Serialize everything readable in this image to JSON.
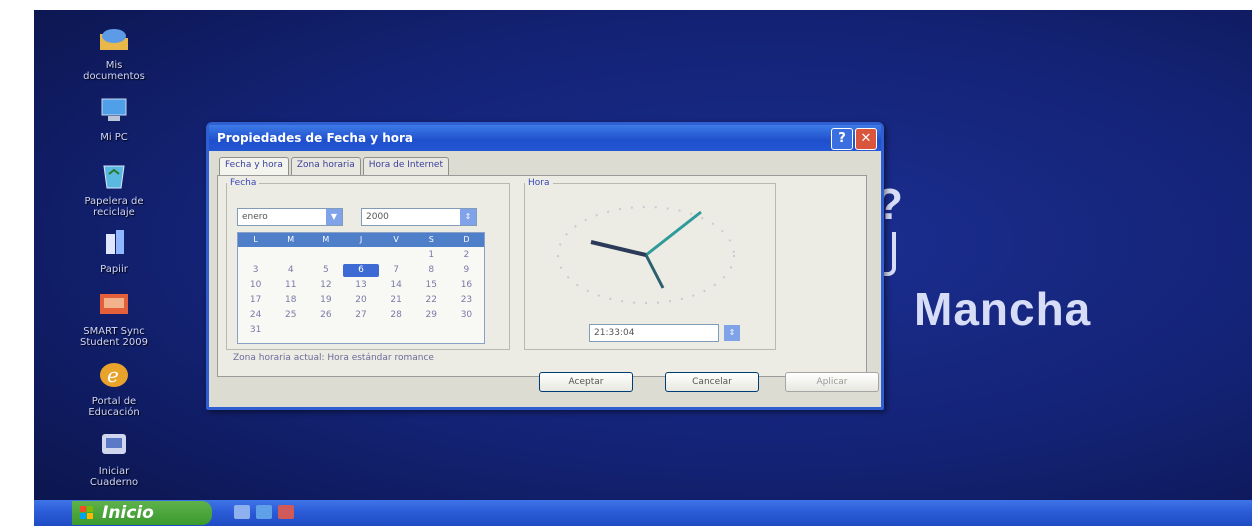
{
  "desktop": {
    "icons": [
      {
        "name": "my-documents-icon",
        "label": "Mis\ndocumentos"
      },
      {
        "name": "my-pc-icon",
        "label": "Mi PC"
      },
      {
        "name": "recycle-bin-icon",
        "label": "Papelera de\nreciclaje"
      },
      {
        "name": "paint-icon",
        "label": "Papiir"
      },
      {
        "name": "smart-sync-icon",
        "label": "SMART Sync\nStudent 2009"
      },
      {
        "name": "education-portal-icon",
        "label": "Portal de\nEducación"
      },
      {
        "name": "notebook-icon",
        "label": "Iniciar\nCuaderno"
      }
    ],
    "wallpaper_text": "Mancha",
    "wallpaper_symbol": "?"
  },
  "dialog": {
    "title": "Propiedades de Fecha y hora",
    "help_glyph": "?",
    "close_glyph": "✕",
    "tabs": [
      "Fecha y hora",
      "Zona horaria",
      "Hora de Internet"
    ],
    "date_group_label": "Fecha",
    "time_group_label": "Hora",
    "month": "enero",
    "year": "2000",
    "weekdays": [
      "L",
      "M",
      "M",
      "J",
      "V",
      "S",
      "D"
    ],
    "days": [
      "",
      "",
      "",
      "",
      "",
      "1",
      "2",
      "3",
      "4",
      "5",
      "6",
      "7",
      "8",
      "9",
      "10",
      "11",
      "12",
      "13",
      "14",
      "15",
      "16",
      "17",
      "18",
      "19",
      "20",
      "21",
      "22",
      "23",
      "24",
      "25",
      "26",
      "27",
      "28",
      "29",
      "30",
      "31"
    ],
    "selected_day": "6",
    "time_value": "21:33:04",
    "timezone_text": "Zona horaria actual:  Hora estándar romance",
    "buttons": {
      "ok": "Aceptar",
      "cancel": "Cancelar",
      "apply": "Aplicar"
    }
  },
  "taskbar": {
    "start_label": "Inicio"
  },
  "colors": {
    "desktop": "#14227a",
    "titlebar": "#1f4fcc",
    "start": "#3a9a2d"
  }
}
